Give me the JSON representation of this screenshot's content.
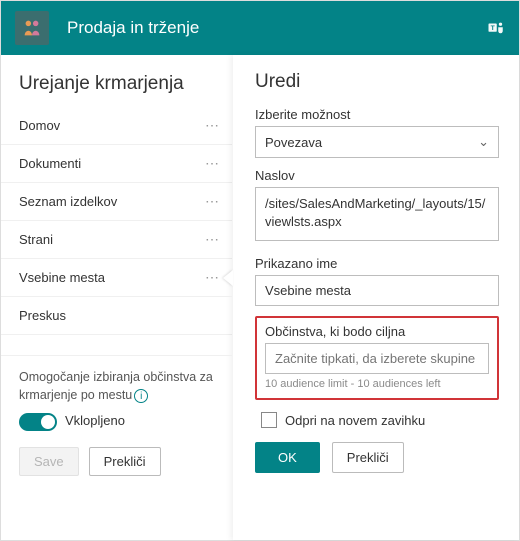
{
  "header": {
    "site_title": "Prodaja in trženje"
  },
  "left": {
    "title": "Urejanje krmarjenja",
    "items": [
      {
        "label": "Domov"
      },
      {
        "label": "Dokumenti"
      },
      {
        "label": "Seznam izdelkov"
      },
      {
        "label": "Strani"
      },
      {
        "label": "Vsebine mesta"
      },
      {
        "label": "Preskus"
      }
    ],
    "audience_toggle": {
      "caption": "Omogočanje izbiranja občinstva za krmarjenje po mestu",
      "state_label": "Vklopljeno"
    },
    "buttons": {
      "save": "Save",
      "cancel": "Prekliči"
    }
  },
  "right": {
    "title": "Uredi",
    "option_label": "Izberite možnost",
    "option_value": "Povezava",
    "address_label": "Naslov",
    "address_value": "/sites/SalesAndMarketing/_layouts/15/viewlsts.aspx",
    "display_label": "Prikazano ime",
    "display_value": "Vsebine mesta",
    "audience_label": "Občinstva, ki bodo ciljna",
    "audience_placeholder": "Začnite tipkati, da izberete skupine",
    "audience_hint": "10 audience limit - 10 audiences left",
    "newtab_label": "Odpri na novem zavihku",
    "buttons": {
      "ok": "OK",
      "cancel": "Prekliči"
    }
  }
}
